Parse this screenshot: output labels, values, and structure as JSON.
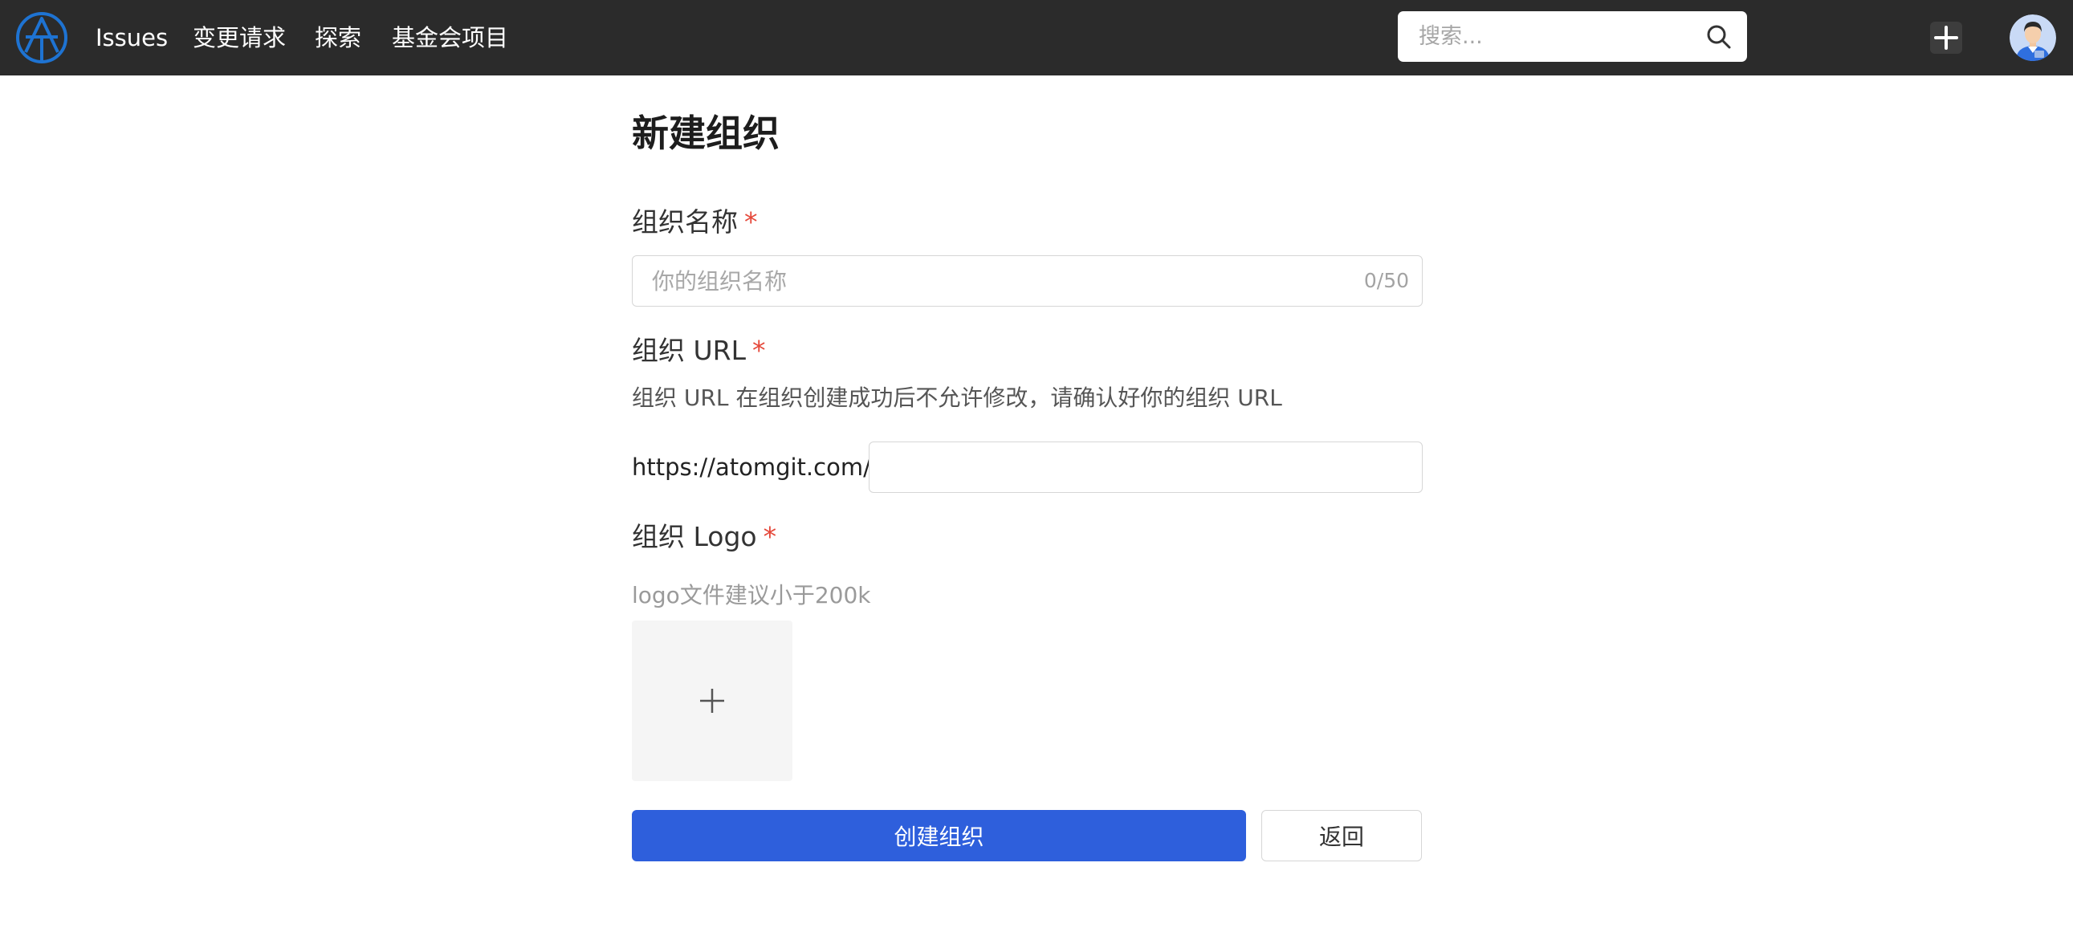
{
  "nav": {
    "items": [
      {
        "label": "Issues"
      },
      {
        "label": "变更请求"
      },
      {
        "label": "探索"
      },
      {
        "label": "基金会项目"
      }
    ],
    "search_placeholder": "搜索...",
    "icons": {
      "logo": "atomgit-logo",
      "search": "search-icon",
      "create": "plus-icon",
      "avatar": "user-avatar"
    }
  },
  "form": {
    "title": "新建组织",
    "required_mark": "*",
    "name": {
      "label": "组织名称",
      "placeholder": "你的组织名称",
      "value": "",
      "counter": "0/50"
    },
    "url": {
      "label": "组织 URL",
      "hint": "组织 URL 在组织创建成功后不允许修改，请确认好你的组织 URL",
      "prefix": "https://atomgit.com/",
      "value": ""
    },
    "logo": {
      "label": "组织 Logo",
      "hint": "logo文件建议小于200k"
    },
    "submit_label": "创建组织",
    "back_label": "返回"
  },
  "colors": {
    "topbar": "#2b2b2b",
    "primary": "#2e5fdc",
    "required": "#e5483a"
  }
}
